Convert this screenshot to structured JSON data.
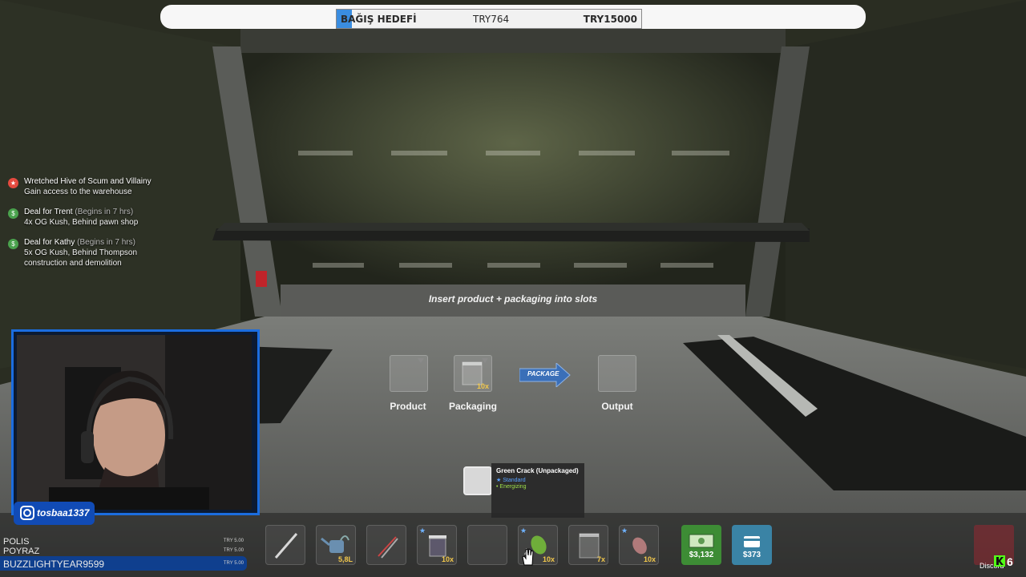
{
  "donation": {
    "label": "BAĞIŞ HEDEFİ",
    "current": "TRY764",
    "goal": "TRY15000",
    "progress": 0.05
  },
  "quests": [
    {
      "icon": "star-icon",
      "title": "Wretched Hive of Scum and Villainy",
      "subtitle": "",
      "desc": "Gain access to the warehouse"
    },
    {
      "icon": "deal-icon",
      "title": "Deal for Trent",
      "subtitle": "(Begins in 7 hrs)",
      "desc": "4x OG Kush, Behind pawn shop"
    },
    {
      "icon": "deal-icon",
      "title": "Deal for Kathy",
      "subtitle": "(Begins in 7 hrs)",
      "desc": "5x OG Kush, Behind Thompson construction and demolition"
    }
  ],
  "packaging": {
    "instruction": "Insert product + packaging into slots",
    "product_label": "Product",
    "packaging_label": "Packaging",
    "packaging_count": "10x",
    "button_label": "PACKAGE",
    "output_label": "Output"
  },
  "tooltip": {
    "name": "Green Crack (Unpackaged)",
    "quality": "★ Standard",
    "effect": "• Energizing"
  },
  "hotbar": [
    {
      "icon": "baton-icon",
      "count": ""
    },
    {
      "icon": "watering-can-icon",
      "count": "5,8L"
    },
    {
      "icon": "trimmers-icon",
      "count": ""
    },
    {
      "icon": "jar-icon",
      "count": "10x",
      "starred": true
    },
    {
      "icon": "empty-slot",
      "count": ""
    },
    {
      "icon": "weed-bud-icon",
      "count": "10x",
      "starred": true
    },
    {
      "icon": "baggie-icon",
      "count": "7x"
    },
    {
      "icon": "meat-icon",
      "count": "10x",
      "starred": true
    }
  ],
  "cash": "$3,132",
  "bank": "$373",
  "streamer": {
    "handle": "tosbaa1337"
  },
  "donors": [
    {
      "name": "POLIS",
      "amount": "TRY 5.00"
    },
    {
      "name": "POYRAZ",
      "amount": "TRY 5.00"
    },
    {
      "name": "BUZZLIGHTYEAR9599",
      "amount": "TRY 5.00"
    }
  ],
  "overlay": {
    "discord": "Discord",
    "number": "6"
  },
  "colors": {
    "donation_fill": "#3a8de0",
    "quest_star": "#e54a3f",
    "quest_deal": "#4aa24d",
    "cash_bg": "#3d8c35",
    "bank_bg": "#3a83a5",
    "webcam_border": "#1b6de0"
  }
}
